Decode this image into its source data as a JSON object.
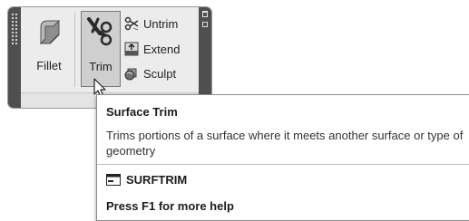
{
  "ribbon": {
    "fillet_label": "Fillet",
    "trim_label": "Trim",
    "untrim_label": "Untrim",
    "extend_label": "Extend",
    "sculpt_label": "Sculpt"
  },
  "tooltip": {
    "title": "Surface Trim",
    "description": "Trims portions of a surface where it meets another surface or type of geometry",
    "command": "SURFTRIM",
    "help": "Press F1 for more help"
  },
  "icons": {
    "fillet": "fillet-surface-icon",
    "trim": "scissors-icon",
    "untrim": "untrim-scissors-icon",
    "extend": "extend-icon",
    "sculpt": "sculpt-icon",
    "command": "command-line-icon"
  }
}
